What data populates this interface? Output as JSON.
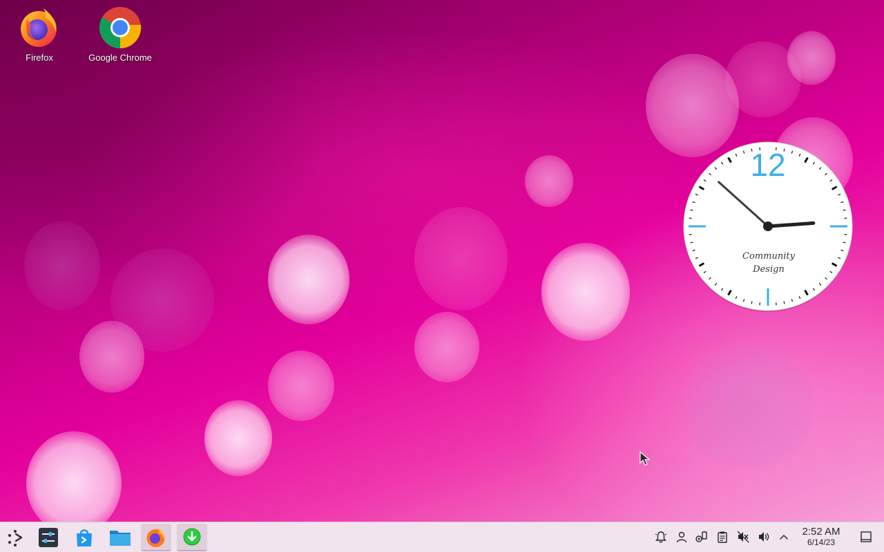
{
  "desktop": {
    "icons": [
      {
        "label": "Firefox",
        "icon": "firefox-icon"
      },
      {
        "label": "Google Chrome",
        "icon": "chrome-icon"
      }
    ],
    "wallpaper_colors": {
      "dark": "#6a0046",
      "mid": "#e4009c",
      "light": "#f6a0d6"
    }
  },
  "clock_widget": {
    "numeral": "12",
    "brand_line1": "Community",
    "brand_line2": "Design",
    "accent_color": "#3daee9",
    "time": "2:52"
  },
  "taskbar": {
    "background": "#f1e4ee",
    "launchers": [
      {
        "name": "application-launcher",
        "icon": "launcher-icon"
      },
      {
        "name": "system-settings",
        "icon": "settings-icon"
      },
      {
        "name": "discover-store",
        "icon": "store-icon"
      },
      {
        "name": "dolphin-files",
        "icon": "folder-icon"
      },
      {
        "name": "firefox",
        "icon": "firefox-icon"
      },
      {
        "name": "downloader",
        "icon": "download-icon"
      }
    ],
    "tray": [
      {
        "icon": "notifications-icon"
      },
      {
        "icon": "user-icon"
      },
      {
        "icon": "kde-connect-icon"
      },
      {
        "icon": "clipboard-icon"
      },
      {
        "icon": "muted-speaker-icon"
      },
      {
        "icon": "volume-icon"
      },
      {
        "icon": "expand-tray-icon"
      }
    ],
    "clock": {
      "time": "2:52 AM",
      "date": "6/14/23"
    },
    "show_desktop": {
      "icon": "show-desktop-icon"
    }
  }
}
